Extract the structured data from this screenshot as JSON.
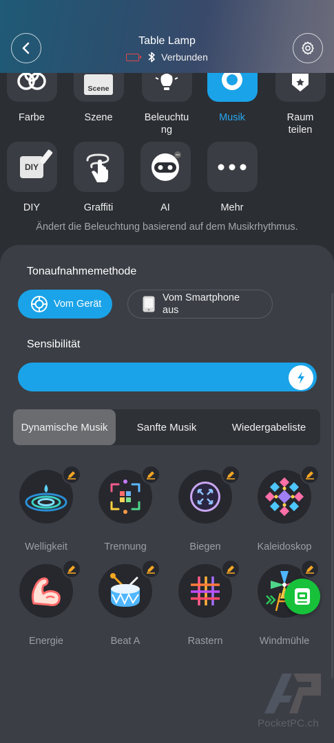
{
  "header": {
    "title": "Table Lamp",
    "connection_status": "Verbunden"
  },
  "features": [
    {
      "label": "Farbe",
      "icon": "color-rings-icon",
      "active": false
    },
    {
      "label": "Szene",
      "icon": "scene-icon",
      "active": false
    },
    {
      "label": "Beleuchtung",
      "icon": "lightbulb-icon",
      "active": false
    },
    {
      "label": "Musik",
      "icon": "music-icon",
      "active": true
    },
    {
      "label": "Raum teilen",
      "icon": "share-room-icon",
      "active": false
    },
    {
      "label": "DIY",
      "icon": "diy-icon",
      "active": false
    },
    {
      "label": "Graffiti",
      "icon": "graffiti-icon",
      "active": false
    },
    {
      "label": "AI",
      "icon": "ai-robot-icon",
      "active": false
    },
    {
      "label": "Mehr",
      "icon": "more-dots-icon",
      "active": false
    }
  ],
  "feature_labels": {
    "farbe": "Farbe",
    "szene": "Szene",
    "beleuchtung_line1": "Beleuchtu",
    "beleuchtung_line2": "ng",
    "musik": "Musik",
    "raum_line1": "Raum",
    "raum_line2": "teilen",
    "diy": "DIY",
    "graffiti": "Graffiti",
    "ai": "AI",
    "mehr": "Mehr",
    "scene_tile_text": "Scene",
    "diy_tile_text": "DIY"
  },
  "description": "Ändert die Beleuchtung basierend auf dem Musikrhythmus.",
  "recording": {
    "title": "Tonaufnahmemethode",
    "options": [
      {
        "label": "Vom Gerät",
        "selected": true
      },
      {
        "label_line1": "Vom Smartphone",
        "label_line2": "aus",
        "selected": false
      }
    ]
  },
  "sensitivity": {
    "title": "Sensibilität",
    "level_fraction": 1.0
  },
  "tabs": [
    {
      "label": "Dynamische Musik",
      "active": true
    },
    {
      "label": "Sanfte Musik",
      "active": false
    },
    {
      "label": "Wiedergabeliste",
      "active": false
    }
  ],
  "effects": [
    {
      "label": "Welligkeit",
      "icon": "ripple-icon"
    },
    {
      "label": "Trennung",
      "icon": "separation-icon"
    },
    {
      "label": "Biegen",
      "icon": "bend-icon"
    },
    {
      "label": "Kaleidoskop",
      "icon": "kaleidoscope-icon"
    },
    {
      "label": "Energie",
      "icon": "energy-arm-icon"
    },
    {
      "label": "Beat A",
      "icon": "drum-icon"
    },
    {
      "label": "Rastern",
      "icon": "grid-icon"
    },
    {
      "label": "Windmühle",
      "icon": "windmill-icon"
    }
  ],
  "watermark": "PocketPC.ch",
  "colors": {
    "accent": "#1aa3e8",
    "active_label": "#26a9f0",
    "edit_badge": "#f5a623",
    "fab": "#17c23a",
    "battery_warning": "#e24848"
  }
}
